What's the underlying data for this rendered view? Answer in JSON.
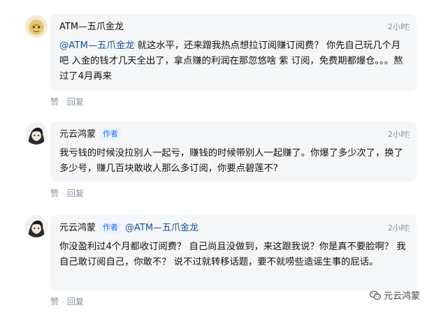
{
  "comments": [
    {
      "author": "ATM—五爪金龙",
      "author_tag": "",
      "time": "2小时",
      "more": "⋮",
      "mention": "@ATM—五爪金龙",
      "text": " 就这水平，还来蹭我热点想拉订阅赚订阅费？ 你先自己玩几个月吧 入金的钱才几天全出了，拿点赚的利润在那忽悠啥 紫 订阅，免费期都爆仓。。。熬过了4月再来",
      "like_label": "赞",
      "reply_label": "回复",
      "separator": "·"
    },
    {
      "author": "元云鸿蒙",
      "author_tag": "作者",
      "time": "2小时",
      "more": "⋮",
      "text": "我亏钱的时候没拉别人一起亏，赚钱的时候带别人一起赚了。你爆了多少次了，换了多少号，赚几百块敢收人那么多订阅，你要点碧莲不?",
      "like_label": "赞",
      "reply_label": "回复",
      "separator": "·"
    },
    {
      "author": "元云鸿蒙",
      "author_tag": "作者",
      "reply_to": "@ATM—五爪金龙",
      "time": "2小时",
      "more": "⋮",
      "text": "你没盈利过4个月都收订阅费？ 自己尚且没做到，来这跟我说？你是真不要脸啊？ 我自己敢订阅自己，你敢不？ 说不过就转移话题，要不就唠些造谣生事的屁话。",
      "like_label": "赞",
      "reply_label": "回复",
      "separator": "·"
    }
  ],
  "watermark": {
    "text": "元云鸿蒙",
    "icon": "weixin-icon"
  },
  "colors": {
    "bubble": "#f5f6f7",
    "link": "#175199",
    "meta": "#8590a6",
    "author_tag": "#1772f6"
  }
}
